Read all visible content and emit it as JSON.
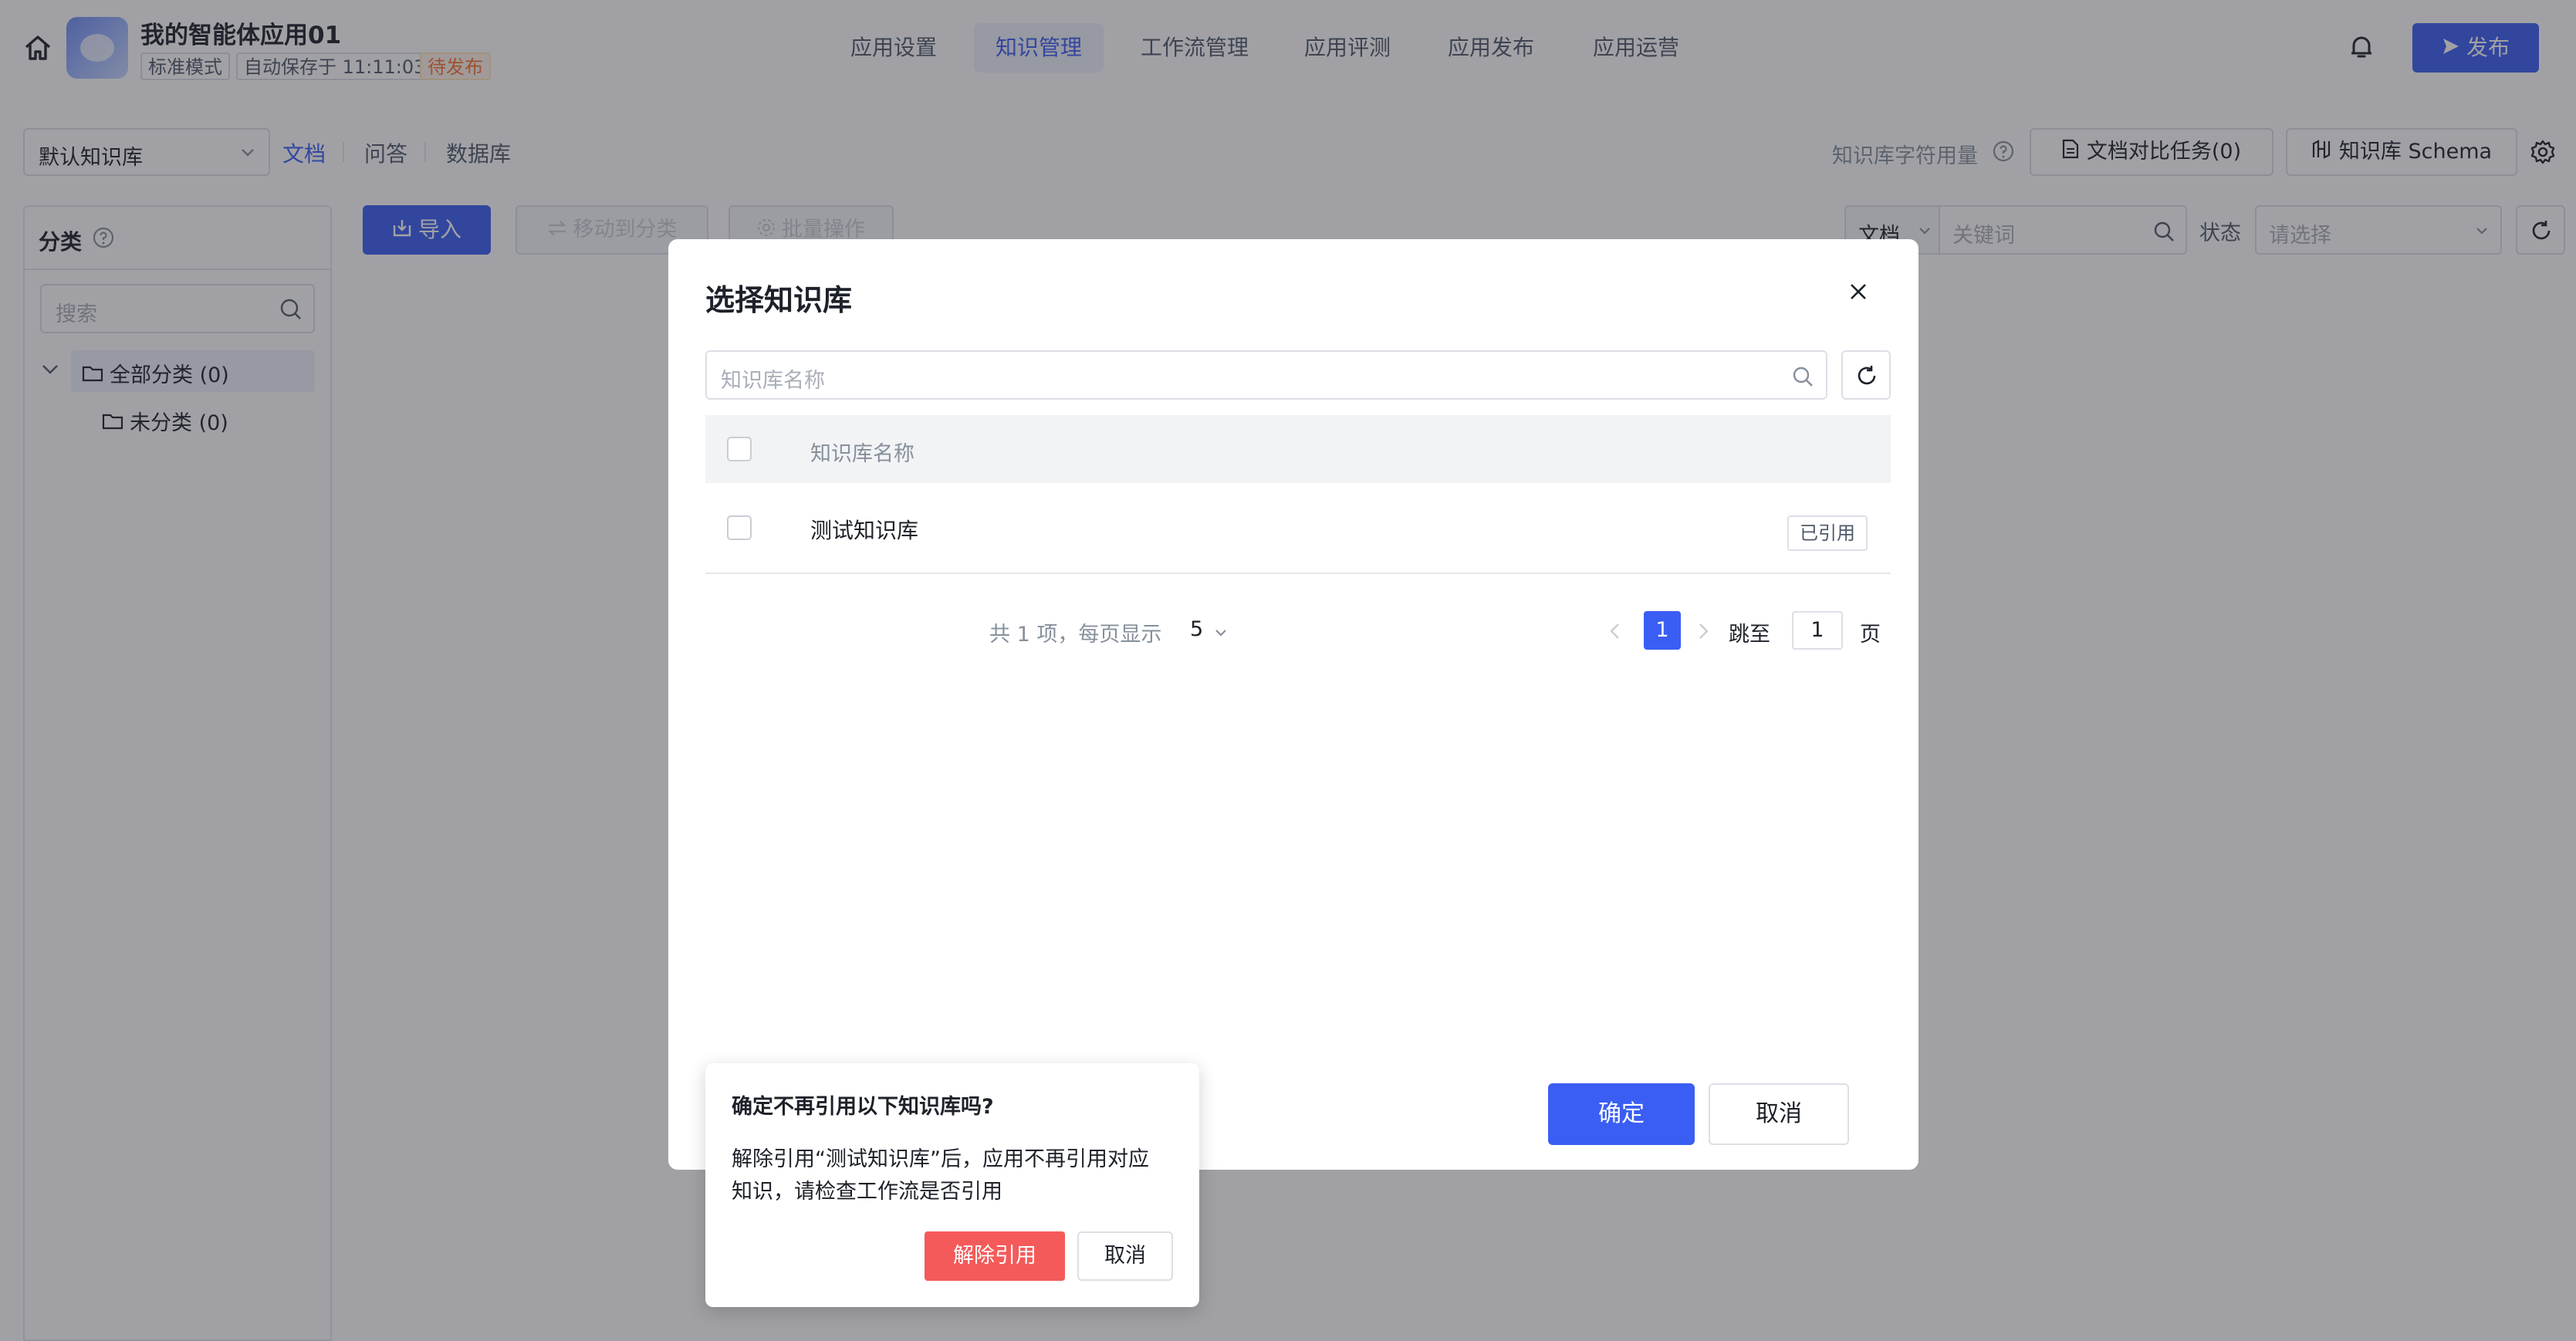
{
  "header": {
    "app_name": "我的智能体应用01",
    "mode_tag": "标准模式",
    "autosave": "自动保存于 11:11:03",
    "status_tag": "待发布",
    "publish_label": "发布",
    "tabs": [
      {
        "label": "应用设置"
      },
      {
        "label": "知识管理"
      },
      {
        "label": "工作流管理"
      },
      {
        "label": "应用评测"
      },
      {
        "label": "应用发布"
      },
      {
        "label": "应用运营"
      }
    ],
    "accent_color": "#3a5ef3"
  },
  "toolbar": {
    "kb_select_value": "默认知识库",
    "sub_tabs": [
      {
        "label": "文档"
      },
      {
        "label": "问答"
      },
      {
        "label": "数据库"
      }
    ],
    "usage_label": "知识库字符用量",
    "compare_button": "文档对比任务(0)",
    "schema_button": "知识库 Schema"
  },
  "sidebar": {
    "title": "分类",
    "search_placeholder": "搜索",
    "tree": [
      {
        "label": "全部分类 (0)"
      },
      {
        "label": "未分类 (0)"
      }
    ]
  },
  "content": {
    "import_button": "导入",
    "move_button": "移动到分类",
    "batch_button": "批量操作",
    "filter_type": "文档",
    "keyword_placeholder": "关键词",
    "status_label": "状态",
    "status_placeholder": "请选择"
  },
  "modal": {
    "title": "选择知识库",
    "search_placeholder": "知识库名称",
    "column_header": "知识库名称",
    "rows": [
      {
        "name": "测试知识库",
        "badge": "已引用"
      }
    ],
    "pagination": {
      "total_text": "共 1 项，每页显示",
      "page_size": "5",
      "current_page": "1",
      "jump_label": "跳至",
      "jump_value": "1",
      "page_suffix": "页"
    },
    "confirm_button": "确定",
    "cancel_button": "取消"
  },
  "popconfirm": {
    "title": "确定不再引用以下知识库吗?",
    "message_line1": "解除引用“测试知识库”后，应用不再引用对应",
    "message_line2": "知识，请检查工作流是否引用",
    "danger_button": "解除引用",
    "cancel_button": "取消",
    "danger_color": "#f55a5a"
  }
}
